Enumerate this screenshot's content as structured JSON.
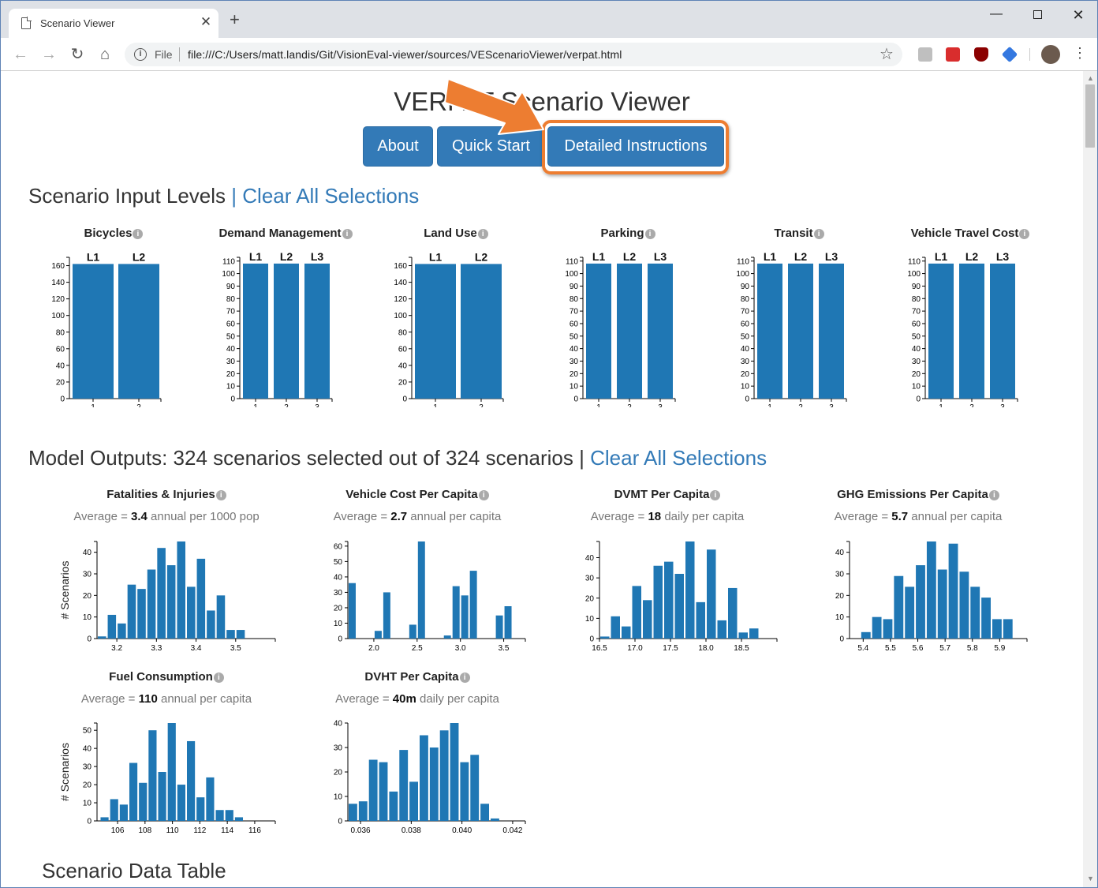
{
  "browser": {
    "tab_title": "Scenario Viewer",
    "scheme_label": "File",
    "url": "file:///C:/Users/matt.landis/Git/VisionEval-viewer/sources/VEScenarioViewer/verpat.html"
  },
  "app": {
    "title": "VERPAT Scenario Viewer",
    "buttons": {
      "about": "About",
      "quick_start": "Quick Start",
      "detailed": "Detailed Instructions"
    }
  },
  "inputs_section": {
    "title": "Scenario Input Levels",
    "separator": "|",
    "clear_link": "Clear All Selections"
  },
  "outputs_section": {
    "title": "Model Outputs: 324 scenarios selected out of 324 scenarios",
    "separator": "|",
    "clear_link": "Clear All Selections"
  },
  "table_section": {
    "title": "Scenario Data Table"
  },
  "colors": {
    "bar": "#1f77b4",
    "link": "#337ab7",
    "button": "#337ab7",
    "highlight": "#ed7d31"
  },
  "icons": {
    "info": "info-circle-icon",
    "arrow": "orange-arrow-annotation"
  },
  "input_charts": [
    {
      "title": "Bicycles",
      "levels": [
        "L1",
        "L2"
      ],
      "x_ticks": [
        "1",
        "2"
      ],
      "values": [
        162,
        162
      ],
      "ylim": [
        0,
        170
      ],
      "yticks": [
        0,
        20,
        40,
        60,
        80,
        100,
        120,
        140,
        160
      ]
    },
    {
      "title": "Demand Management",
      "levels": [
        "L1",
        "L2",
        "L3"
      ],
      "x_ticks": [
        "1",
        "2",
        "3"
      ],
      "values": [
        108,
        108,
        108
      ],
      "ylim": [
        0,
        113
      ],
      "yticks": [
        0,
        10,
        20,
        30,
        40,
        50,
        60,
        70,
        80,
        90,
        100,
        110
      ]
    },
    {
      "title": "Land Use",
      "levels": [
        "L1",
        "L2"
      ],
      "x_ticks": [
        "1",
        "2"
      ],
      "values": [
        162,
        162
      ],
      "ylim": [
        0,
        170
      ],
      "yticks": [
        0,
        20,
        40,
        60,
        80,
        100,
        120,
        140,
        160
      ]
    },
    {
      "title": "Parking",
      "levels": [
        "L1",
        "L2",
        "L3"
      ],
      "x_ticks": [
        "1",
        "2",
        "3"
      ],
      "values": [
        108,
        108,
        108
      ],
      "ylim": [
        0,
        113
      ],
      "yticks": [
        0,
        10,
        20,
        30,
        40,
        50,
        60,
        70,
        80,
        90,
        100,
        110
      ]
    },
    {
      "title": "Transit",
      "levels": [
        "L1",
        "L2",
        "L3"
      ],
      "x_ticks": [
        "1",
        "2",
        "3"
      ],
      "values": [
        108,
        108,
        108
      ],
      "ylim": [
        0,
        113
      ],
      "yticks": [
        0,
        10,
        20,
        30,
        40,
        50,
        60,
        70,
        80,
        90,
        100,
        110
      ]
    },
    {
      "title": "Vehicle Travel Cost",
      "levels": [
        "L1",
        "L2",
        "L3"
      ],
      "x_ticks": [
        "1",
        "2",
        "3"
      ],
      "values": [
        108,
        108,
        108
      ],
      "ylim": [
        0,
        113
      ],
      "yticks": [
        0,
        10,
        20,
        30,
        40,
        50,
        60,
        70,
        80,
        90,
        100,
        110
      ]
    }
  ],
  "chart_data": [
    {
      "type": "bar",
      "title": "Fatalities & Injuries",
      "avg_prefix": "Average = ",
      "avg_value": "3.4",
      "avg_unit": " annual per 1000 pop",
      "ylabel": "# Scenarios",
      "xlim": [
        3.15,
        3.6
      ],
      "ylim": [
        0,
        45
      ],
      "yticks": [
        0,
        10,
        20,
        30,
        40
      ],
      "xticks": [
        {
          "v": 3.2,
          "t": "3.2"
        },
        {
          "v": 3.3,
          "t": "3.3"
        },
        {
          "v": 3.4,
          "t": "3.4"
        },
        {
          "v": 3.5,
          "t": "3.5"
        }
      ],
      "bins": [
        3.15,
        3.175,
        3.2,
        3.225,
        3.25,
        3.275,
        3.3,
        3.325,
        3.35,
        3.375,
        3.4,
        3.425,
        3.45,
        3.475,
        3.5,
        3.525,
        3.55,
        3.575,
        3.6
      ],
      "values": [
        1,
        11,
        7,
        25,
        23,
        32,
        42,
        34,
        45,
        24,
        37,
        13,
        20,
        4,
        4
      ]
    },
    {
      "type": "bar",
      "title": "Vehicle Cost Per Capita",
      "avg_prefix": "Average = ",
      "avg_value": "2.7",
      "avg_unit": " annual per capita",
      "ylabel": "",
      "xlim": [
        1.7,
        3.75
      ],
      "ylim": [
        0,
        63
      ],
      "yticks": [
        0,
        10,
        20,
        30,
        40,
        50,
        60
      ],
      "xticks": [
        {
          "v": 2.0,
          "t": "2.0"
        },
        {
          "v": 2.5,
          "t": "2.5"
        },
        {
          "v": 3.0,
          "t": "3.0"
        },
        {
          "v": 3.5,
          "t": "3.5"
        }
      ],
      "bins": [
        1.7,
        1.8,
        1.9,
        2.0,
        2.1,
        2.2,
        2.3,
        2.4,
        2.5,
        2.6,
        2.7,
        2.8,
        2.9,
        3.0,
        3.1,
        3.2,
        3.3,
        3.4,
        3.5,
        3.6,
        3.7
      ],
      "values": [
        36,
        0,
        0,
        5,
        30,
        0,
        0,
        9,
        63,
        0,
        0,
        2,
        34,
        28,
        44,
        0,
        0,
        15,
        21
      ]
    },
    {
      "type": "bar",
      "title": "DVMT Per Capita",
      "avg_prefix": "Average = ",
      "avg_value": "18",
      "avg_unit": " daily per capita",
      "ylabel": "",
      "xlim": [
        16.5,
        19.0
      ],
      "ylim": [
        0,
        48
      ],
      "yticks": [
        0,
        10,
        20,
        30,
        40
      ],
      "xticks": [
        {
          "v": 16.5,
          "t": "16.5"
        },
        {
          "v": 17.0,
          "t": "17.0"
        },
        {
          "v": 17.5,
          "t": "17.5"
        },
        {
          "v": 18.0,
          "t": "18.0"
        },
        {
          "v": 18.5,
          "t": "18.5"
        }
      ],
      "bins": [
        16.5,
        16.65,
        16.8,
        16.95,
        17.1,
        17.25,
        17.4,
        17.55,
        17.7,
        17.85,
        18.0,
        18.15,
        18.3,
        18.45,
        18.6,
        18.75,
        18.9
      ],
      "values": [
        1,
        11,
        6,
        26,
        19,
        36,
        38,
        32,
        48,
        18,
        44,
        9,
        25,
        3,
        5
      ]
    },
    {
      "type": "bar",
      "title": "GHG Emissions Per Capita",
      "avg_prefix": "Average = ",
      "avg_value": "5.7",
      "avg_unit": " annual per capita",
      "ylabel": "",
      "xlim": [
        5.35,
        6.0
      ],
      "ylim": [
        0,
        45
      ],
      "yticks": [
        0,
        10,
        20,
        30,
        40
      ],
      "xticks": [
        {
          "v": 5.4,
          "t": "5.4"
        },
        {
          "v": 5.5,
          "t": "5.5"
        },
        {
          "v": 5.6,
          "t": "5.6"
        },
        {
          "v": 5.7,
          "t": "5.7"
        },
        {
          "v": 5.8,
          "t": "5.8"
        },
        {
          "v": 5.9,
          "t": "5.9"
        }
      ],
      "bins": [
        5.35,
        5.39,
        5.43,
        5.47,
        5.51,
        5.55,
        5.59,
        5.63,
        5.67,
        5.71,
        5.75,
        5.79,
        5.83,
        5.87,
        5.91,
        5.95
      ],
      "values": [
        0,
        3,
        10,
        9,
        29,
        24,
        34,
        45,
        32,
        44,
        31,
        24,
        19,
        9,
        9
      ]
    },
    {
      "type": "bar",
      "title": "Fuel Consumption",
      "avg_prefix": "Average = ",
      "avg_value": "110",
      "avg_unit": " annual per capita",
      "ylabel": "# Scenarios",
      "xlim": [
        104.5,
        117.5
      ],
      "ylim": [
        0,
        54
      ],
      "yticks": [
        0,
        10,
        20,
        30,
        40,
        50
      ],
      "xticks": [
        {
          "v": 106,
          "t": "106"
        },
        {
          "v": 108,
          "t": "108"
        },
        {
          "v": 110,
          "t": "110"
        },
        {
          "v": 112,
          "t": "112"
        },
        {
          "v": 114,
          "t": "114"
        },
        {
          "v": 116,
          "t": "116"
        }
      ],
      "bins": [
        104.7,
        105.4,
        106.1,
        106.8,
        107.5,
        108.2,
        108.9,
        109.6,
        110.3,
        111.0,
        111.7,
        112.4,
        113.1,
        113.8,
        114.5,
        115.2,
        115.9,
        116.6
      ],
      "values": [
        2,
        12,
        9,
        32,
        21,
        50,
        27,
        54,
        20,
        44,
        13,
        24,
        6,
        6,
        2
      ]
    },
    {
      "type": "bar",
      "title": "DVHT Per Capita",
      "avg_prefix": "Average = ",
      "avg_value": "40m",
      "avg_unit": " daily per capita",
      "ylabel": "",
      "xlim": [
        0.0355,
        0.0425
      ],
      "ylim": [
        0,
        40
      ],
      "yticks": [
        0,
        10,
        20,
        30,
        40
      ],
      "xticks": [
        {
          "v": 0.036,
          "t": "0.036"
        },
        {
          "v": 0.038,
          "t": "0.038"
        },
        {
          "v": 0.04,
          "t": "0.040"
        },
        {
          "v": 0.042,
          "t": "0.042"
        }
      ],
      "bins": [
        0.0355,
        0.0359,
        0.0363,
        0.0367,
        0.0371,
        0.0375,
        0.0379,
        0.0383,
        0.0387,
        0.0391,
        0.0395,
        0.0399,
        0.0403,
        0.0407,
        0.0411,
        0.0415,
        0.0419,
        0.0423
      ],
      "values": [
        7,
        8,
        25,
        24,
        12,
        29,
        16,
        35,
        30,
        37,
        40,
        24,
        27,
        7,
        1
      ]
    }
  ]
}
